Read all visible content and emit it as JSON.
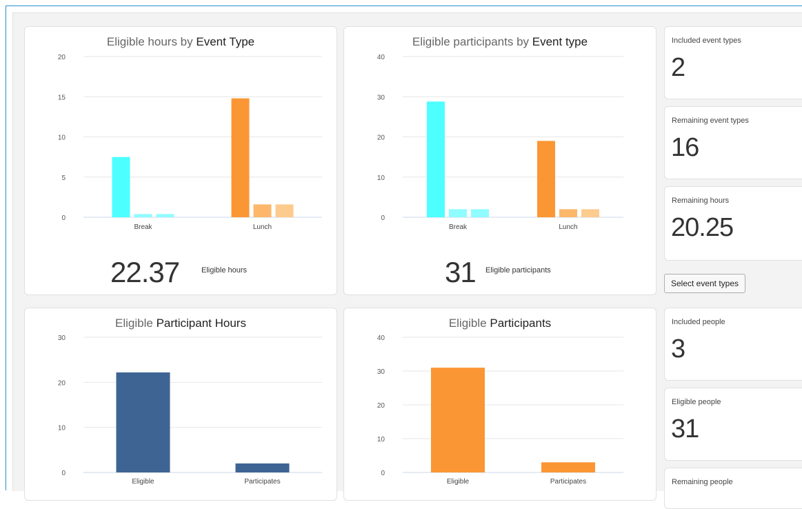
{
  "charts": {
    "hours_by_type": {
      "title_pre": "Eligible hours by ",
      "title_bold": "Event Type",
      "big_value": "22.37",
      "big_label": "Eligible hours"
    },
    "participants_by_type": {
      "title_pre": "Eligible participants by ",
      "title_bold": "Event type",
      "big_value": "31",
      "big_label": "Eligible participants"
    },
    "participant_hours": {
      "title_pre": "Eligible ",
      "title_bold": "Participant Hours"
    },
    "participants": {
      "title_pre": "Eligible ",
      "title_bold": "Participants"
    }
  },
  "kpis": {
    "included_event_types": {
      "label": "Included event types",
      "value": "2"
    },
    "remaining_event_types": {
      "label": "Remaining event types",
      "value": "16"
    },
    "remaining_hours": {
      "label": "Remaining hours",
      "value": "20.25"
    },
    "included_people": {
      "label": "Included people",
      "value": "3"
    },
    "eligible_people": {
      "label": "Eligible people",
      "value": "31"
    },
    "remaining_people": {
      "label": "Remaining people",
      "value": ""
    }
  },
  "buttons": {
    "select_event_types": "Select event types"
  },
  "colors": {
    "cyan": "#4dffff",
    "cyan_light": "#8ffcff",
    "orange": "#fb9634",
    "orange_mid": "#fcb76a",
    "orange_light": "#fdcb8e",
    "blue": "#3e6494"
  },
  "chart_data": [
    {
      "type": "bar",
      "categories": [
        "Break",
        "Lunch"
      ],
      "series": [
        {
          "values": [
            7.5,
            14.8
          ]
        },
        {
          "values": [
            0.4,
            1.6
          ]
        },
        {
          "values": [
            0.4,
            1.6
          ]
        }
      ],
      "ylim": [
        0,
        20
      ],
      "yticks": [
        0,
        5,
        10,
        15,
        20
      ],
      "grid": true
    },
    {
      "type": "bar",
      "categories": [
        "Break",
        "Lunch"
      ],
      "series": [
        {
          "values": [
            28.8,
            19
          ]
        },
        {
          "values": [
            2,
            2
          ]
        },
        {
          "values": [
            2,
            2
          ]
        }
      ],
      "ylim": [
        0,
        40
      ],
      "yticks": [
        0,
        10,
        20,
        30,
        40
      ],
      "grid": true
    },
    {
      "type": "bar",
      "categories": [
        "Eligible",
        "Participates"
      ],
      "values": [
        22.2,
        2
      ],
      "ylim": [
        0,
        30
      ],
      "yticks": [
        0,
        10,
        20,
        30
      ],
      "grid": true
    },
    {
      "type": "bar",
      "categories": [
        "Eligible",
        "Participates"
      ],
      "values": [
        31,
        3
      ],
      "ylim": [
        0,
        40
      ],
      "yticks": [
        0,
        10,
        20,
        30,
        40
      ],
      "grid": true
    }
  ]
}
